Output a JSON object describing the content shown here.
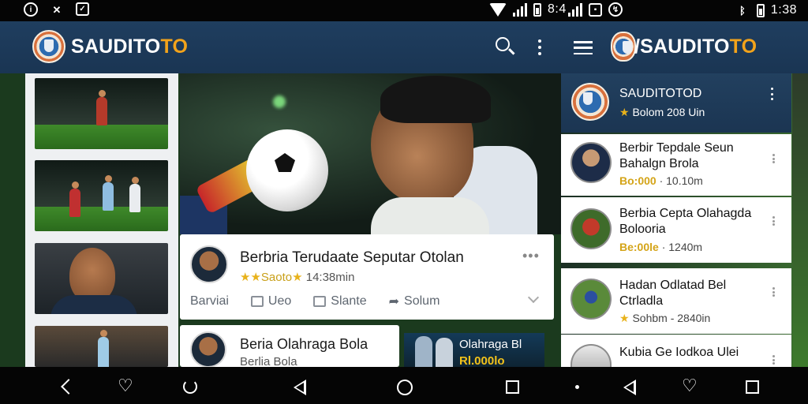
{
  "status_bar": {
    "left_icons": [
      "info-icon",
      "x-icon",
      "check-icon"
    ],
    "time_left": "8:4",
    "time_right": "1:38"
  },
  "left_app": {
    "brand_main": "SAUDITO",
    "brand_accent": "TO",
    "icons": [
      "search-icon",
      "more-vert-icon"
    ]
  },
  "right_app": {
    "brand_main": "SAUDITO",
    "brand_accent": "TO",
    "brand_prefix": "/",
    "profile": {
      "name": "SAUDITOTOD",
      "star": "★",
      "sub": "Bolom  208 Uin"
    },
    "items": [
      {
        "title_line1": "Berbir Tepdale Seun",
        "title_line2": "Bahalgn Brola",
        "meta_gold": "Bo:000",
        "meta": "· 10.10m"
      },
      {
        "title_line1": "Berbia Cepta Olahagda",
        "title_line2": "Bolooria",
        "meta_gold": "Be:00le",
        "meta": "· 1240m"
      },
      {
        "title_line1": "Hadan Odlatad Bel",
        "title_line2": "Ctrladla",
        "meta_star": "★",
        "meta": "Sohbm - 2840in"
      },
      {
        "title_line1": "Kubia Ge Iodkoa Ulei",
        "title_line2": "",
        "meta": ""
      }
    ]
  },
  "hero_card": {
    "title": "Berbria Terudaate Seputar Otolan",
    "stars": "★★",
    "sub_gold": "Saoto",
    "sub_star": "★",
    "sub_rest": "14:38min",
    "more": "•••",
    "actions": [
      {
        "label": "Barviai",
        "icon": ""
      },
      {
        "label": "Ueo",
        "icon": "comment-icon"
      },
      {
        "label": "Slante",
        "icon": "bookmark-icon"
      },
      {
        "label": "Solum",
        "icon": "share-icon"
      }
    ]
  },
  "second_card": {
    "title": "Beria Olahraga Bola",
    "sub": "Berlia Bola"
  },
  "promo_card": {
    "title": "Olahraga Bl",
    "value": "Rl.000lo"
  },
  "nav_bar": {
    "icons": [
      "back-icon",
      "heart-icon",
      "refresh-icon",
      "back-triangle-icon",
      "home-circle-icon",
      "recents-square-icon",
      "dot-icon",
      "back-triangle-icon",
      "heart-icon",
      "recents-square-icon"
    ]
  },
  "colors": {
    "header_blue": "#1f3e5f",
    "accent_orange": "#f2a31b",
    "gold": "#e8b21b"
  }
}
